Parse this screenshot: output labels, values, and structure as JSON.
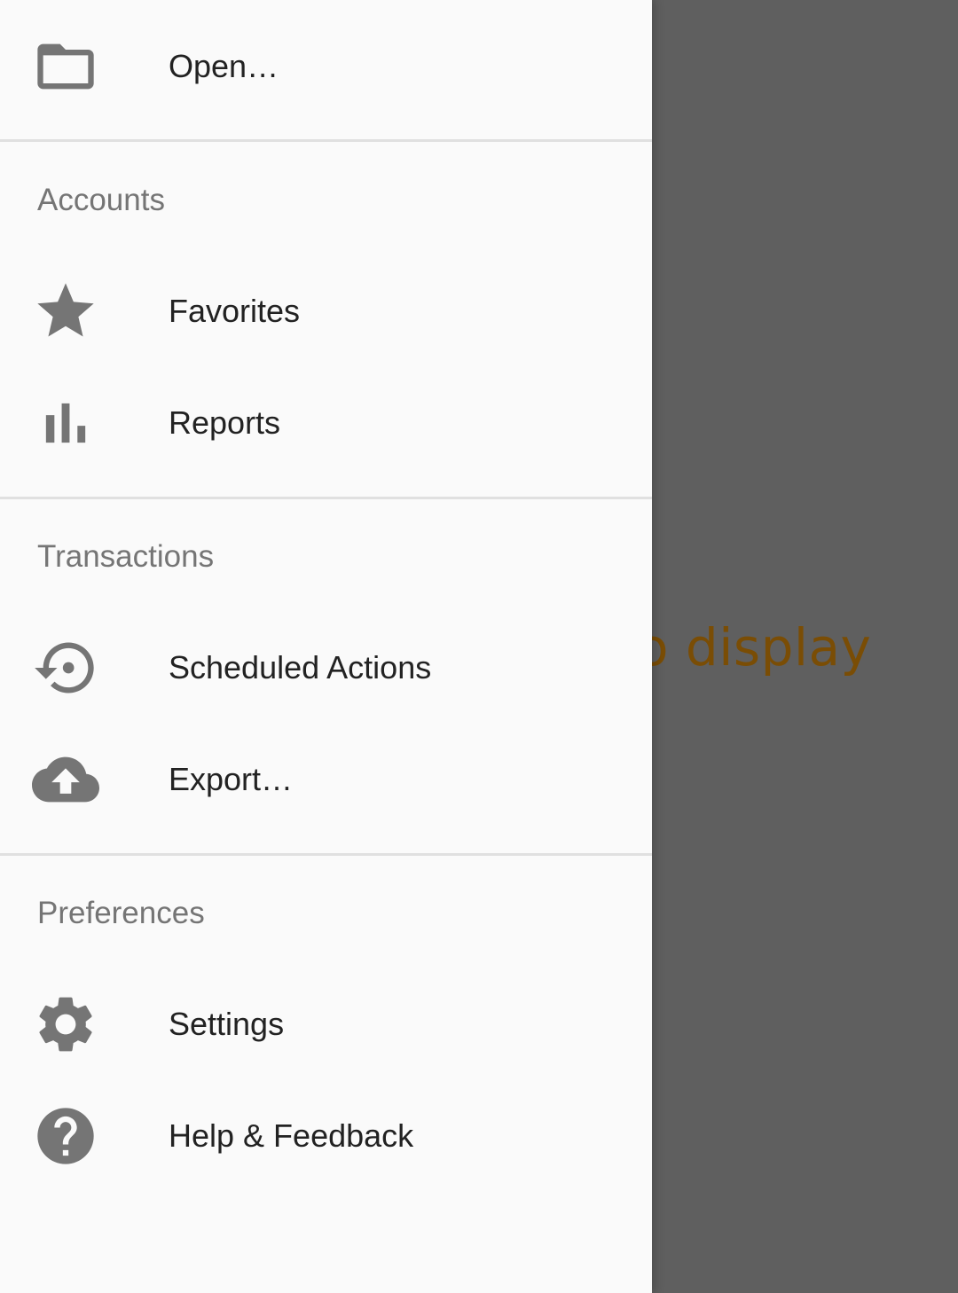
{
  "background": {
    "partial_text": "o display",
    "scrim_color": "#5f5f5f",
    "text_color": "#7a4d05"
  },
  "drawer": {
    "open_item": {
      "label": "Open…",
      "icon": "folder-icon"
    },
    "sections": [
      {
        "header": "Accounts",
        "items": [
          {
            "label": "Favorites",
            "icon": "star-icon"
          },
          {
            "label": "Reports",
            "icon": "bar-chart-icon"
          }
        ]
      },
      {
        "header": "Transactions",
        "items": [
          {
            "label": "Scheduled Actions",
            "icon": "history-icon"
          },
          {
            "label": "Export…",
            "icon": "cloud-upload-icon"
          }
        ]
      },
      {
        "header": "Preferences",
        "items": [
          {
            "label": "Settings",
            "icon": "gear-icon"
          },
          {
            "label": "Help & Feedback",
            "icon": "help-icon"
          }
        ]
      }
    ],
    "icon_color": "#757575",
    "label_color": "#222222",
    "header_color": "#757575"
  }
}
